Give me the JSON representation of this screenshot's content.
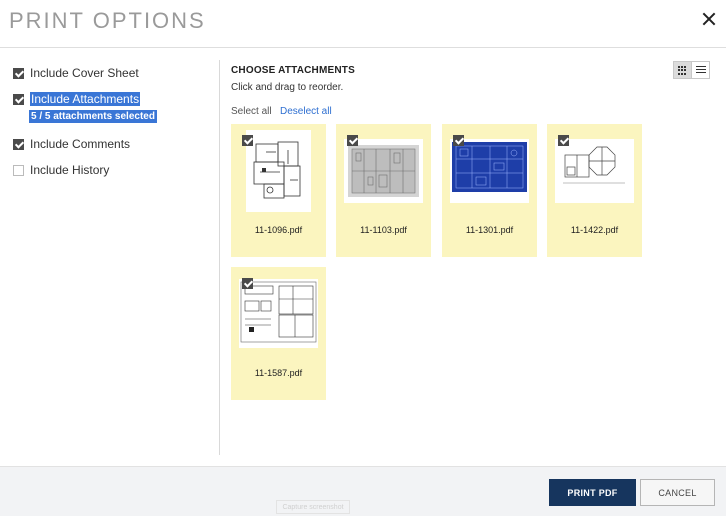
{
  "header": {
    "title": "PRINT OPTIONS"
  },
  "options": [
    {
      "label": "Include Cover Sheet",
      "checked": true
    },
    {
      "label": "Include Attachments",
      "checked": true,
      "highlighted": true
    },
    {
      "label": "Include Comments",
      "checked": true
    },
    {
      "label": "Include History",
      "checked": false
    }
  ],
  "attachments_summary": "5 / 5 attachments selected",
  "main": {
    "heading": "CHOOSE ATTACHMENTS",
    "hint": "Click and drag to reorder.",
    "select_all": "Select all",
    "deselect_all": "Deselect all",
    "view_modes": [
      "grid-view-icon",
      "list-view-icon"
    ],
    "active_view": "grid"
  },
  "attachments": [
    {
      "name": "11-1096.pdf",
      "checked": true,
      "thumb": "floorplan"
    },
    {
      "name": "11-1103.pdf",
      "checked": true,
      "thumb": "gray-plan"
    },
    {
      "name": "11-1301.pdf",
      "checked": true,
      "thumb": "blueprint"
    },
    {
      "name": "11-1422.pdf",
      "checked": true,
      "thumb": "octagon-plan"
    },
    {
      "name": "11-1587.pdf",
      "checked": true,
      "thumb": "sheet-plan"
    }
  ],
  "footer": {
    "print_label": "PRINT PDF",
    "cancel_label": "CANCEL",
    "faint_label": "Capture screenshot"
  },
  "colors": {
    "card_bg": "#fbf5bf",
    "primary": "#16355e",
    "selection": "#3a76d6",
    "link": "#2e6fd1"
  }
}
